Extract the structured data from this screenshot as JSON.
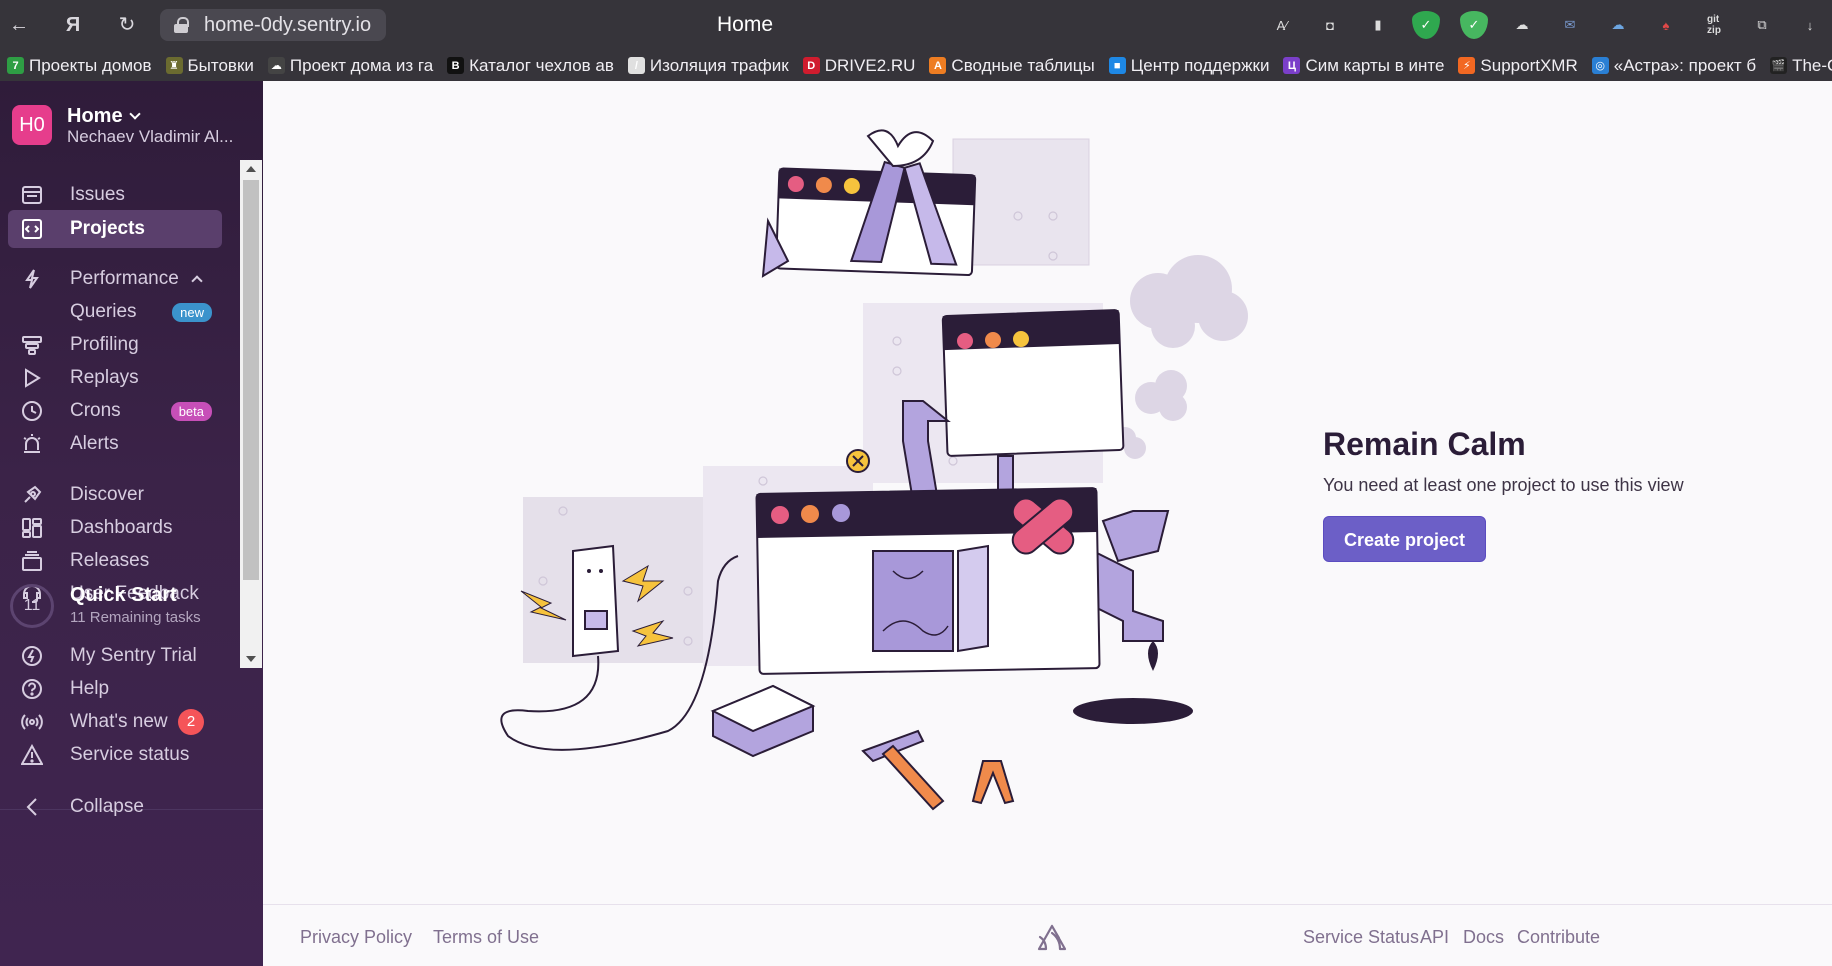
{
  "browser": {
    "url": "home-0dy.sentry.io",
    "tab_title": "Home",
    "bookmarks": [
      {
        "label": "Проекты домов",
        "color": "#2e9e44",
        "glyph": "7"
      },
      {
        "label": "Бытовки",
        "color": "#6b6b30",
        "glyph": "♜"
      },
      {
        "label": "Проект дома из га",
        "color": "#444444",
        "glyph": "☁"
      },
      {
        "label": "Каталог чехлов ав",
        "color": "#111111",
        "glyph": "B"
      },
      {
        "label": "Изоляция трафик",
        "color": "#e0e0e0",
        "glyph": "/"
      },
      {
        "label": "DRIVE2.RU",
        "color": "#d01c2e",
        "glyph": "D"
      },
      {
        "label": "Сводные таблицы",
        "color": "#ee7d22",
        "glyph": "A"
      },
      {
        "label": "Центр поддержки",
        "color": "#1e88e5",
        "glyph": "■"
      },
      {
        "label": "Сим карты в инте",
        "color": "#7b3fc9",
        "glyph": "Ц"
      },
      {
        "label": "SupportXMR",
        "color": "#f26822",
        "glyph": "⚡"
      },
      {
        "label": "«Астра»: проект б",
        "color": "#2a7fd4",
        "glyph": "◎"
      },
      {
        "label": "The-Cin",
        "color": "#222222",
        "glyph": "🎬"
      }
    ],
    "extensions": [
      "translate-icon",
      "shield-counter-icon",
      "bookmark-icon",
      "adguard-icon",
      "adguard-green-icon",
      "weather-icon",
      "mail-icon",
      "cloud-icon",
      "hat-icon",
      "gitzip-icon",
      "translator-icon",
      "download-icon"
    ]
  },
  "sidebar": {
    "org": {
      "initials": "H0",
      "name": "Home",
      "user": "Nechaev Vladimir Al..."
    },
    "items": [
      {
        "key": "issues",
        "label": "Issues",
        "icon": "issues-icon"
      },
      {
        "key": "projects",
        "label": "Projects",
        "icon": "projects-icon",
        "active": true
      },
      {
        "key": "performance",
        "label": "Performance",
        "icon": "performance-icon"
      },
      {
        "key": "queries",
        "label": "Queries",
        "badge": "new"
      },
      {
        "key": "profiling",
        "label": "Profiling",
        "icon": "profiling-icon"
      },
      {
        "key": "replays",
        "label": "Replays",
        "icon": "replays-icon"
      },
      {
        "key": "crons",
        "label": "Crons",
        "icon": "crons-icon",
        "badge": "beta"
      },
      {
        "key": "alerts",
        "label": "Alerts",
        "icon": "alerts-icon"
      },
      {
        "key": "discover",
        "label": "Discover",
        "icon": "discover-icon"
      },
      {
        "key": "dashboards",
        "label": "Dashboards",
        "icon": "dashboards-icon"
      },
      {
        "key": "releases",
        "label": "Releases",
        "icon": "releases-icon"
      },
      {
        "key": "user_feedback",
        "label": "User Feedback",
        "icon": "feedback-icon"
      }
    ],
    "quick_start": {
      "count": "11",
      "title": "Quick Start",
      "subtitle": "11 Remaining tasks"
    },
    "bottom_items": [
      {
        "key": "trial",
        "label": "My Sentry Trial",
        "icon": "lightning-icon"
      },
      {
        "key": "help",
        "label": "Help",
        "icon": "help-icon"
      },
      {
        "key": "whats_new",
        "label": "What's new",
        "icon": "broadcast-icon",
        "count": "2"
      },
      {
        "key": "service_status",
        "label": "Service status",
        "icon": "warning-icon"
      }
    ],
    "collapse_label": "Collapse"
  },
  "main": {
    "title": "Remain Calm",
    "description": "You need at least one project to use this view",
    "button_label": "Create project"
  },
  "footer": {
    "left_links": [
      "Privacy Policy",
      "Terms of Use"
    ],
    "right_links": [
      "Service Status",
      "API",
      "Docs",
      "Contribute"
    ]
  },
  "colors": {
    "sidebar_bg": "#3b2348",
    "accent": "#6c5fc7",
    "org_avatar": "#e63d8c",
    "badge_new": "#3b93cc",
    "badge_beta": "#c74fb8",
    "badge_count": "#f55459"
  }
}
